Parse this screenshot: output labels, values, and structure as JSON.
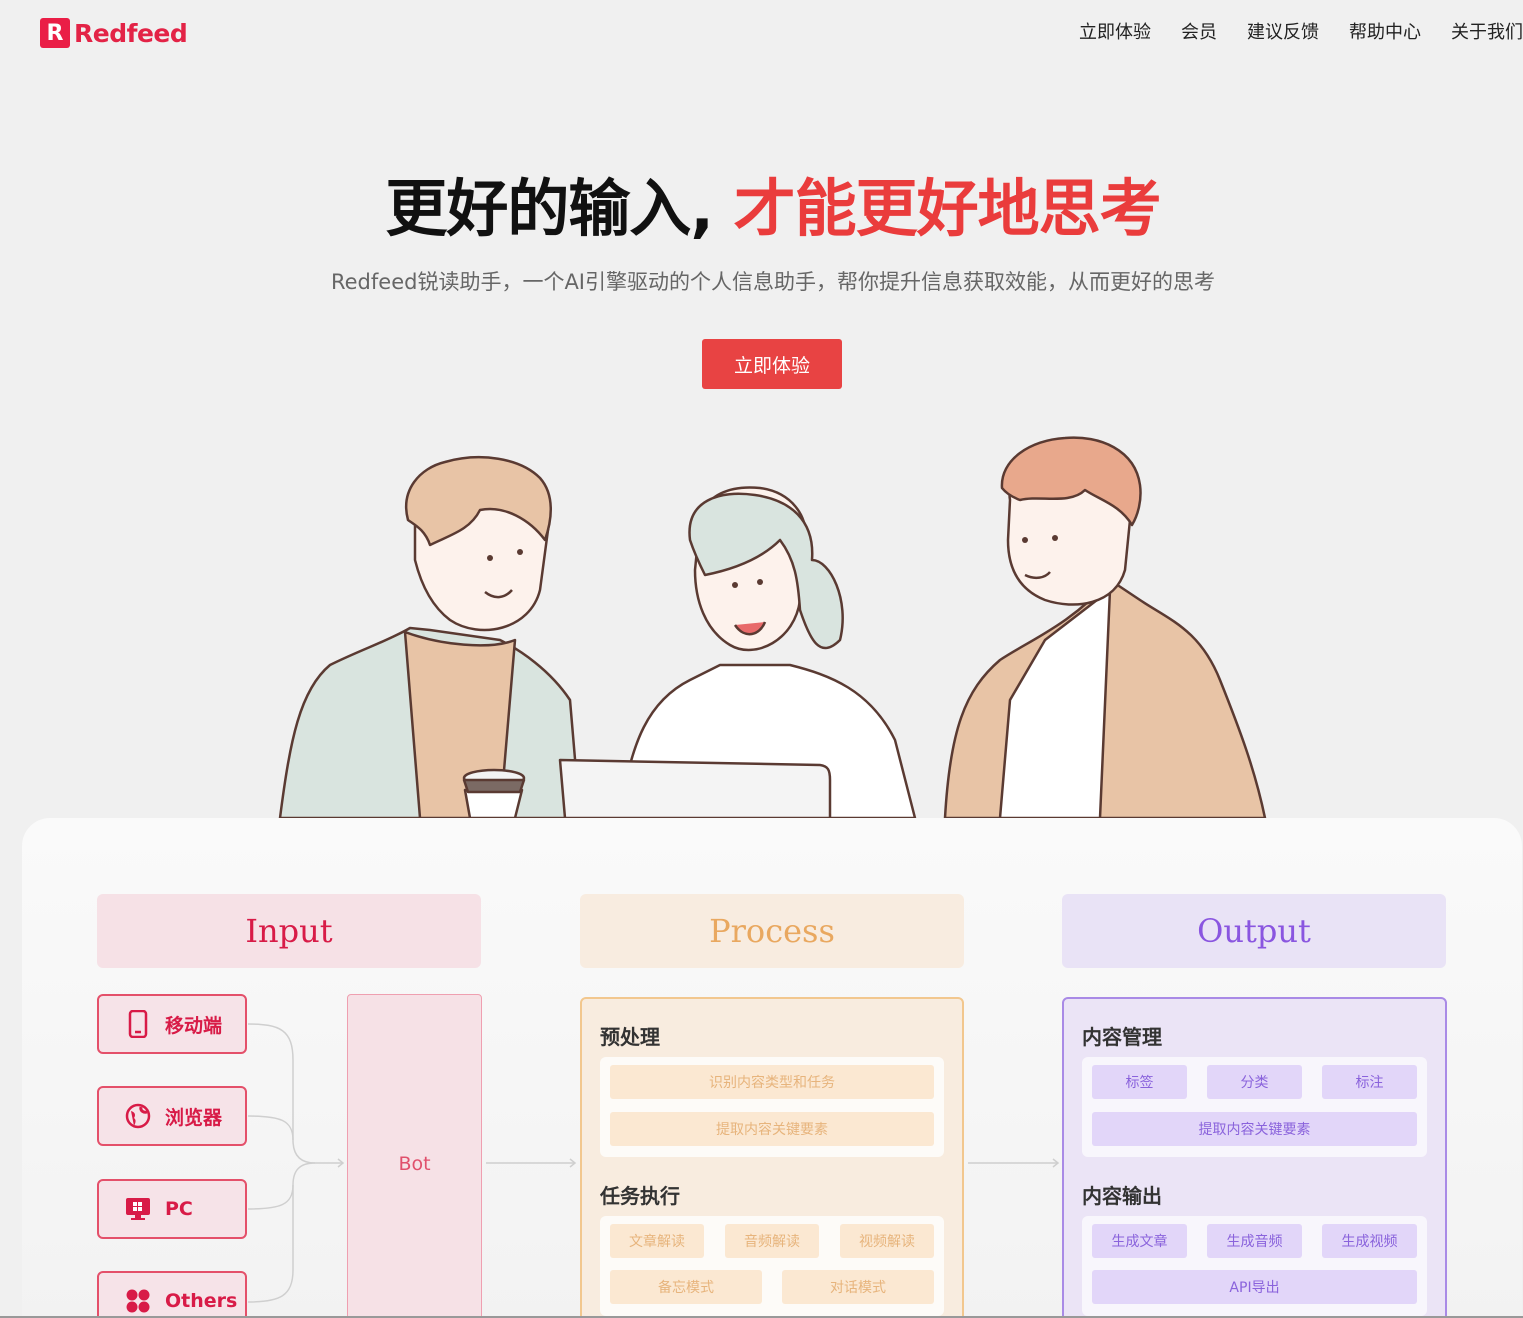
{
  "brand": {
    "mark": "R",
    "name": "Redfeed"
  },
  "nav": [
    "立即体验",
    "会员",
    "建议反馈",
    "帮助中心",
    "关于我们"
  ],
  "hero": {
    "title_black": "更好的输入,",
    "title_red": "才能更好地思考",
    "subtitle": "Redfeed锐读助手，一个AI引擎驱动的个人信息助手，帮你提升信息获取效能，从而更好的思考",
    "cta": "立即体验"
  },
  "flow": {
    "input": {
      "title": "Input",
      "sources": [
        {
          "label": "移动端",
          "icon": "mobile-icon"
        },
        {
          "label": "浏览器",
          "icon": "globe-icon"
        },
        {
          "label": "PC",
          "icon": "pc-icon"
        },
        {
          "label": "Others",
          "icon": "grid-icon"
        }
      ],
      "bot": "Bot"
    },
    "process": {
      "title": "Process",
      "preprocess": {
        "title": "预处理",
        "items": [
          "识别内容类型和任务",
          "提取内容关键要素"
        ]
      },
      "tasks": {
        "title": "任务执行",
        "items": [
          "文章解读",
          "音频解读",
          "视频解读",
          "备忘模式",
          "对话模式"
        ]
      }
    },
    "output": {
      "title": "Output",
      "manage": {
        "title": "内容管理",
        "items": [
          "标签",
          "分类",
          "标注",
          "提取内容关键要素"
        ]
      },
      "export": {
        "title": "内容输出",
        "items": [
          "生成文章",
          "生成音频",
          "生成视频",
          "API导出"
        ]
      }
    }
  },
  "colors": {
    "brand_red": "#ea1e46",
    "process_orange": "#e9a860",
    "output_purple": "#8a56e0"
  }
}
